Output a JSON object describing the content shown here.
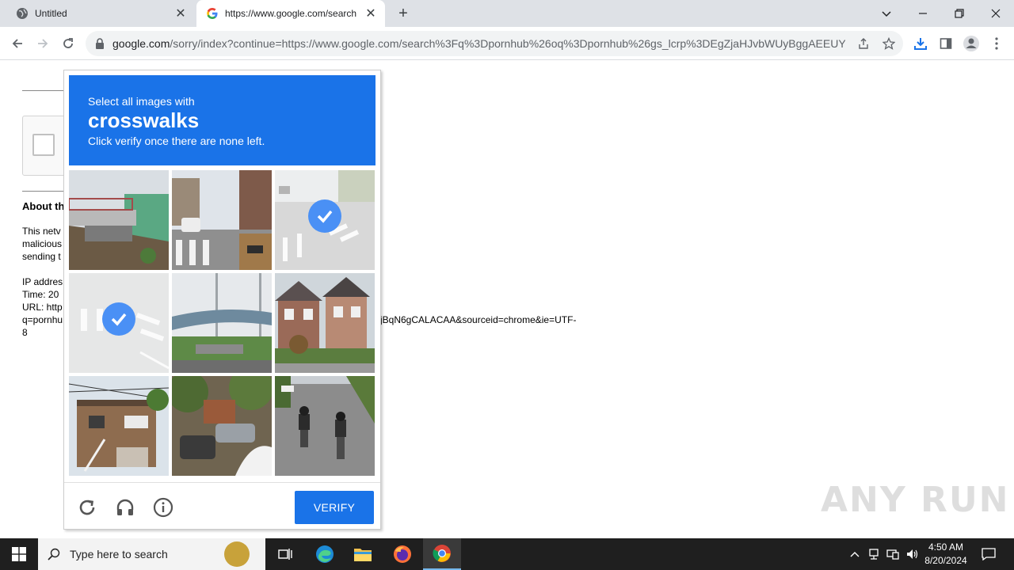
{
  "browser": {
    "tabs": [
      {
        "title": "Untitled",
        "active": false
      },
      {
        "title": "https://www.google.com/search",
        "active": true
      }
    ],
    "address": {
      "domain": "google.com",
      "rest": "/sorry/index?continue=https://www.google.com/search%3Fq%3Dpornhub%26oq%3Dpornhub%26gs_lcrp%3DEgZjaHJvbWUyBggAEEUYO..."
    }
  },
  "page": {
    "about_heading": "About th",
    "paragraph_lines": [
      "This netv",
      "malicious",
      "sending t"
    ],
    "info_lines": [
      "IP addres",
      "Time: 20",
      "URL: http",
      "q=pornhu",
      "8"
    ],
    "url_continuation": "jBqN6gCALACAA&sourceid=chrome&ie=UTF-"
  },
  "captcha": {
    "instruction_line1": "Select all images with",
    "target": "crosswalks",
    "instruction_line3": "Click verify once there are none left.",
    "verify_label": "VERIFY",
    "tiles": [
      {
        "scene": "overpass",
        "selected": false
      },
      {
        "scene": "street-crosswalk",
        "selected": false
      },
      {
        "scene": "crosswalk",
        "selected": true
      },
      {
        "scene": "crosswalk",
        "selected": true
      },
      {
        "scene": "bridge",
        "selected": false
      },
      {
        "scene": "houses",
        "selected": false
      },
      {
        "scene": "house",
        "selected": false
      },
      {
        "scene": "street-cars",
        "selected": false
      },
      {
        "scene": "motorcycles",
        "selected": false
      }
    ],
    "accent_color": "#1a73e8"
  },
  "watermark": "ANY RUN",
  "taskbar": {
    "search_placeholder": "Type here to search",
    "time": "4:50 AM",
    "date": "8/20/2024"
  }
}
